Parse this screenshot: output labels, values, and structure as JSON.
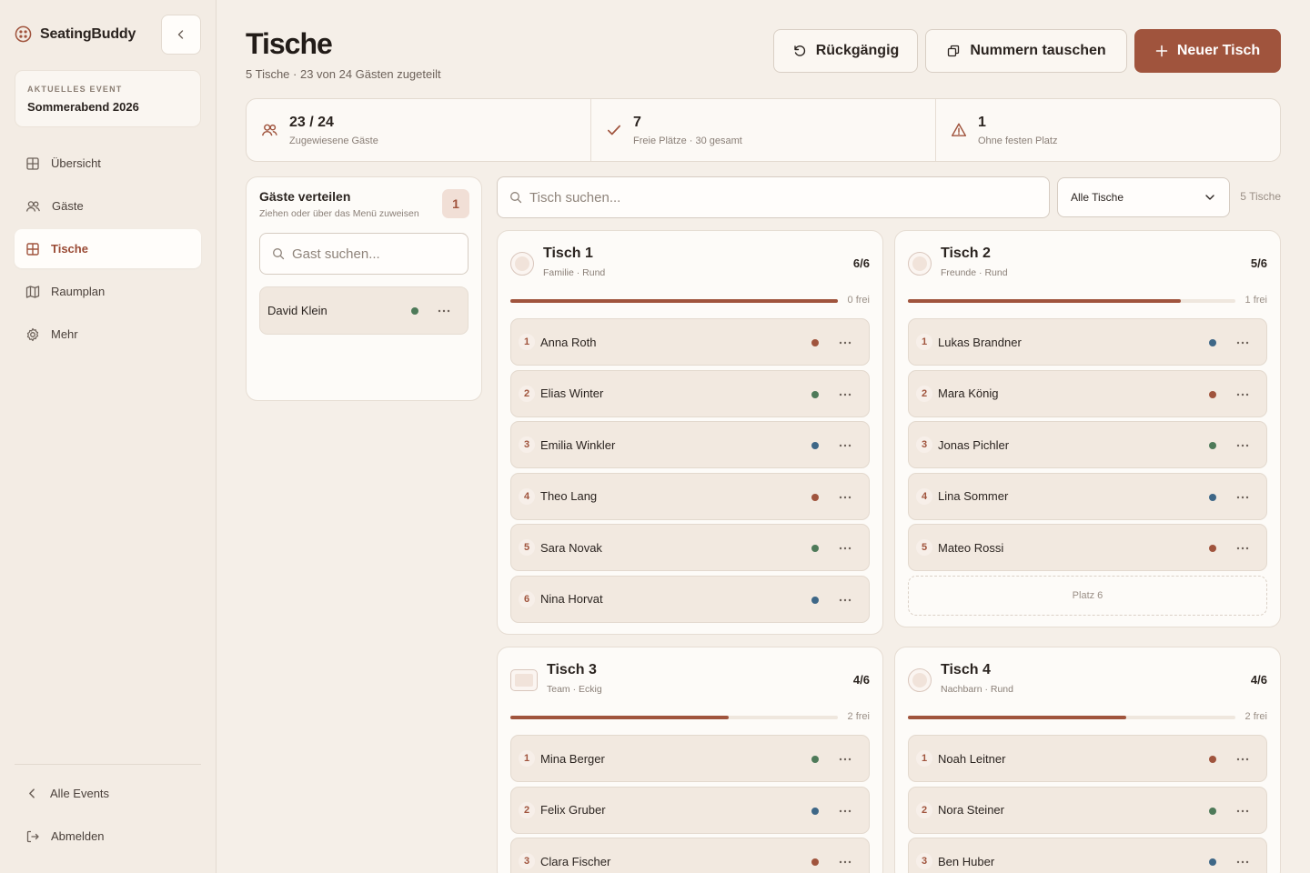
{
  "brand": {
    "name": "SeatingBuddy"
  },
  "event": {
    "kicker": "AKTUELLES EVENT",
    "name": "Sommerabend 2026"
  },
  "nav": [
    {
      "label": "Übersicht",
      "icon": "grid-icon"
    },
    {
      "label": "Gäste",
      "icon": "users-icon"
    },
    {
      "label": "Tische",
      "icon": "table-icon"
    },
    {
      "label": "Raumplan",
      "icon": "map-icon"
    },
    {
      "label": "Mehr",
      "icon": "gear-icon"
    }
  ],
  "bottom_nav": [
    {
      "label": "Alle Events",
      "icon": "chevron-left-icon"
    },
    {
      "label": "Abmelden",
      "icon": "logout-icon"
    }
  ],
  "header": {
    "title": "Tische",
    "subtitle": "5 Tische · 23 von 24 Gästen zugeteilt",
    "undo_label": "Rückgängig",
    "swap_label": "Nummern tauschen",
    "new_label": "Neuer Tisch"
  },
  "stats": [
    {
      "value": "23 / 24",
      "label": "Zugewiesene Gäste",
      "icon": "users-icon"
    },
    {
      "value": "7",
      "label": "Freie Plätze · 30 gesamt",
      "icon": "check-icon"
    },
    {
      "value": "1",
      "label": "Ohne festen Platz",
      "icon": "warning-icon"
    }
  ],
  "unassigned": {
    "title": "Gäste verteilen",
    "subtitle": "Ziehen oder über das Menü zuweisen",
    "count": "1",
    "search_placeholder": "Gast suchen...",
    "guests": [
      {
        "name": "David Klein",
        "color": "#4e7a59"
      }
    ]
  },
  "toolbar": {
    "search_placeholder": "Tisch suchen...",
    "filter_value": "Alle Tische",
    "count_label": "5 Tische"
  },
  "colors": {
    "accent": "#a0543d",
    "red": "#a0543d",
    "green": "#4e7a59",
    "blue": "#3e6787"
  },
  "tables": [
    {
      "name": "Tisch 1",
      "meta": "Familie · Rund",
      "shape": "round",
      "occupancy": "6/6",
      "fill": 1.0,
      "free_label": "0 frei",
      "seats": [
        {
          "num": "1",
          "name": "Anna Roth",
          "color": "#a0543d"
        },
        {
          "num": "2",
          "name": "Elias Winter",
          "color": "#4e7a59"
        },
        {
          "num": "3",
          "name": "Emilia Winkler",
          "color": "#3e6787"
        },
        {
          "num": "4",
          "name": "Theo Lang",
          "color": "#a0543d"
        },
        {
          "num": "5",
          "name": "Sara Novak",
          "color": "#4e7a59"
        },
        {
          "num": "6",
          "name": "Nina Horvat",
          "color": "#3e6787"
        }
      ],
      "empty_seats": []
    },
    {
      "name": "Tisch 2",
      "meta": "Freunde · Rund",
      "shape": "round",
      "occupancy": "5/6",
      "fill": 0.8333,
      "free_label": "1 frei",
      "seats": [
        {
          "num": "1",
          "name": "Lukas Brandner",
          "color": "#3e6787"
        },
        {
          "num": "2",
          "name": "Mara König",
          "color": "#a0543d"
        },
        {
          "num": "3",
          "name": "Jonas Pichler",
          "color": "#4e7a59"
        },
        {
          "num": "4",
          "name": "Lina Sommer",
          "color": "#3e6787"
        },
        {
          "num": "5",
          "name": "Mateo Rossi",
          "color": "#a0543d"
        }
      ],
      "empty_seats": [
        "Platz 6"
      ]
    },
    {
      "name": "Tisch 3",
      "meta": "Team · Eckig",
      "shape": "rect",
      "occupancy": "4/6",
      "fill": 0.6667,
      "free_label": "2 frei",
      "seats": [
        {
          "num": "1",
          "name": "Mina Berger",
          "color": "#4e7a59"
        },
        {
          "num": "2",
          "name": "Felix Gruber",
          "color": "#3e6787"
        },
        {
          "num": "3",
          "name": "Clara Fischer",
          "color": "#a0543d"
        }
      ],
      "empty_seats": []
    },
    {
      "name": "Tisch 4",
      "meta": "Nachbarn · Rund",
      "shape": "round",
      "occupancy": "4/6",
      "fill": 0.6667,
      "free_label": "2 frei",
      "seats": [
        {
          "num": "1",
          "name": "Noah Leitner",
          "color": "#a0543d"
        },
        {
          "num": "2",
          "name": "Nora Steiner",
          "color": "#4e7a59"
        },
        {
          "num": "3",
          "name": "Ben Huber",
          "color": "#3e6787"
        }
      ],
      "empty_seats": []
    }
  ]
}
